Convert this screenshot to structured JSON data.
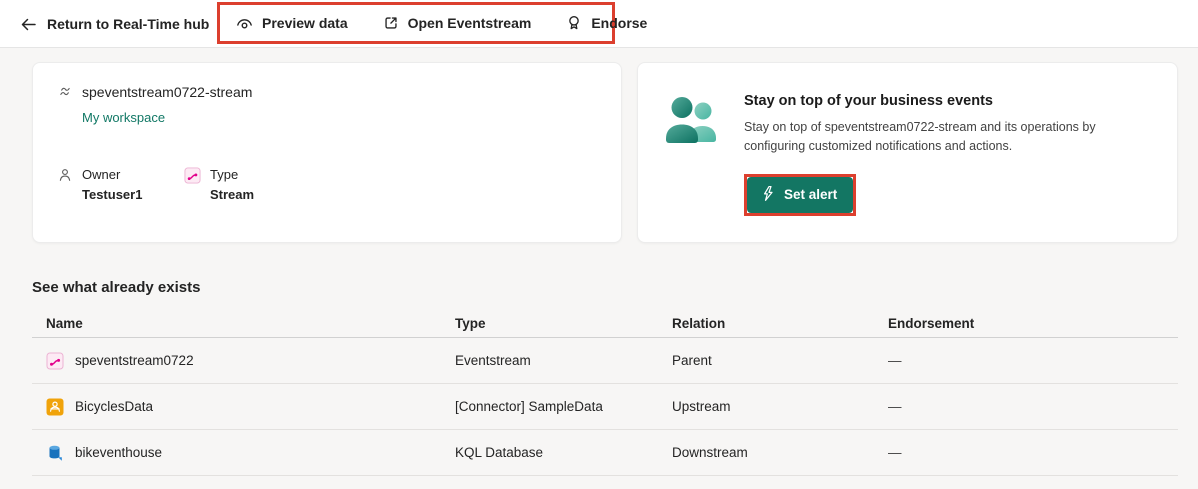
{
  "toolbar": {
    "back_label": "Return to Real-Time hub",
    "actions": [
      {
        "label": "Preview data",
        "icon": "preview-eye-icon"
      },
      {
        "label": "Open Eventstream",
        "icon": "open-external-icon"
      },
      {
        "label": "Endorse",
        "icon": "endorse-ribbon-icon"
      }
    ]
  },
  "info_card": {
    "title": "speventstream0722-stream",
    "title_icon": "stream-icon",
    "workspace_link": "My workspace",
    "owner_label": "Owner",
    "owner_value": "Testuser1",
    "type_label": "Type",
    "type_value": "Stream"
  },
  "alert_card": {
    "icon": "people-icon",
    "title": "Stay on top of your business events",
    "description": "Stay on top of speventstream0722-stream and its operations by configuring customized notifications and actions.",
    "set_alert_label": "Set alert"
  },
  "related_section": {
    "heading": "See what already exists",
    "columns": [
      "Name",
      "Type",
      "Relation",
      "Endorsement"
    ],
    "rows": [
      {
        "icon": "eventstream-icon",
        "name": "speventstream0722",
        "type": "Eventstream",
        "relation": "Parent",
        "endorsement": "—"
      },
      {
        "icon": "connector-bicycle-icon",
        "name": "BicyclesData",
        "type": "[Connector] SampleData",
        "relation": "Upstream",
        "endorsement": "—"
      },
      {
        "icon": "kql-database-icon",
        "name": "bikeventhouse",
        "type": "KQL Database",
        "relation": "Downstream",
        "endorsement": "—"
      }
    ]
  },
  "colors": {
    "annotation_red": "#dc3f2e",
    "accent_teal": "#117865",
    "set_alert_teal": "#137663",
    "eventstream_pink": "#e3008c",
    "connector_amber": "#f0a30a",
    "database_blue": "#1872bd"
  }
}
